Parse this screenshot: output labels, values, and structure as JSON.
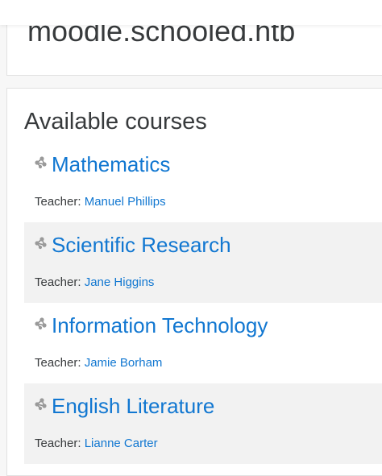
{
  "site": {
    "title": "moodle.schooled.htb"
  },
  "available_courses": {
    "heading": "Available courses",
    "teacher_label": "Teacher: ",
    "courses": [
      {
        "name": "Mathematics",
        "teacher": "Manuel Phillips"
      },
      {
        "name": "Scientific Research",
        "teacher": "Jane Higgins"
      },
      {
        "name": "Information Technology",
        "teacher": "Jamie Borham"
      },
      {
        "name": "English Literature",
        "teacher": "Lianne Carter"
      }
    ]
  },
  "icons": {
    "course": "course-icon"
  },
  "colors": {
    "link": "#1177d1",
    "text": "#373a3c",
    "alt_row_background": "#f2f2f2",
    "page_background": "#f7f7f7"
  }
}
